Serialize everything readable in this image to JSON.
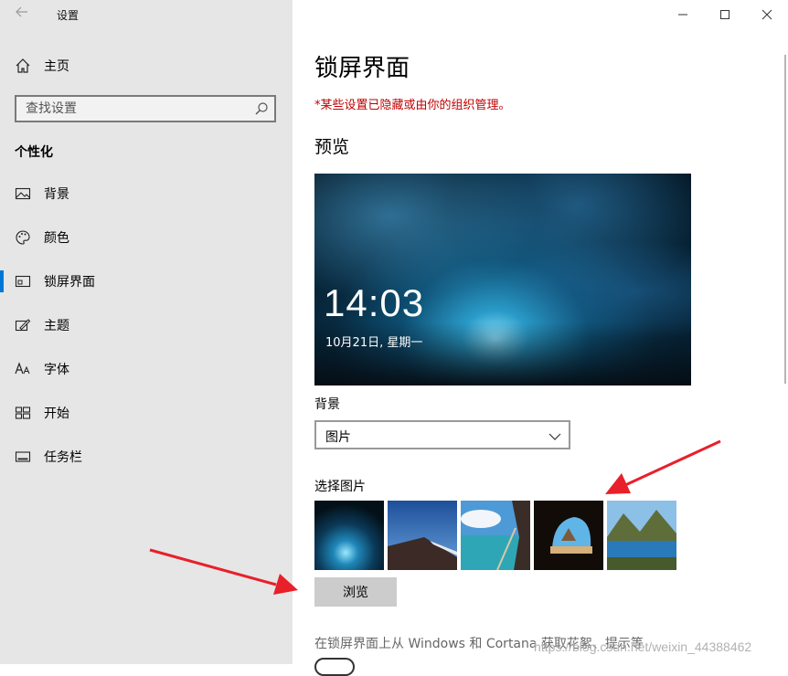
{
  "window": {
    "title": "设置",
    "controls": [
      "minimize",
      "maximize",
      "close"
    ]
  },
  "sidebar": {
    "home": {
      "label": "主页",
      "icon": "home-icon"
    },
    "search": {
      "placeholder": "查找设置",
      "icon": "search-icon"
    },
    "section_header": "个性化",
    "items": [
      {
        "label": "背景",
        "icon": "picture-icon",
        "active": false
      },
      {
        "label": "颜色",
        "icon": "palette-icon",
        "active": false
      },
      {
        "label": "锁屏界面",
        "icon": "lock-screen-icon",
        "active": true
      },
      {
        "label": "主题",
        "icon": "brush-icon",
        "active": false
      },
      {
        "label": "字体",
        "icon": "font-icon",
        "active": false
      },
      {
        "label": "开始",
        "icon": "start-grid-icon",
        "active": false
      },
      {
        "label": "任务栏",
        "icon": "taskbar-icon",
        "active": false
      }
    ]
  },
  "main": {
    "page_title": "锁屏界面",
    "warning": "*某些设置已隐藏或由你的组织管理。",
    "preview_title": "预览",
    "preview": {
      "time": "14:03",
      "date": "10月21日, 星期一"
    },
    "background_label": "背景",
    "background_select": {
      "value": "图片",
      "options": [
        "图片"
      ]
    },
    "choose_picture_label": "选择图片",
    "thumbnails": [
      "ice-cave",
      "mountain-slope",
      "beach-rock",
      "cave-beach",
      "mountain-lake"
    ],
    "browse_button": "浏览",
    "tip_text": "在锁屏界面上从 Windows 和 Cortana 获取花絮、提示等",
    "watermark": "https://blog.csdn.net/weixin_44388462"
  },
  "colors": {
    "accent": "#0078d7",
    "sidebar_bg": "#e6e6e6",
    "warning": "#c00000",
    "annotation_arrow": "#e8202a"
  }
}
